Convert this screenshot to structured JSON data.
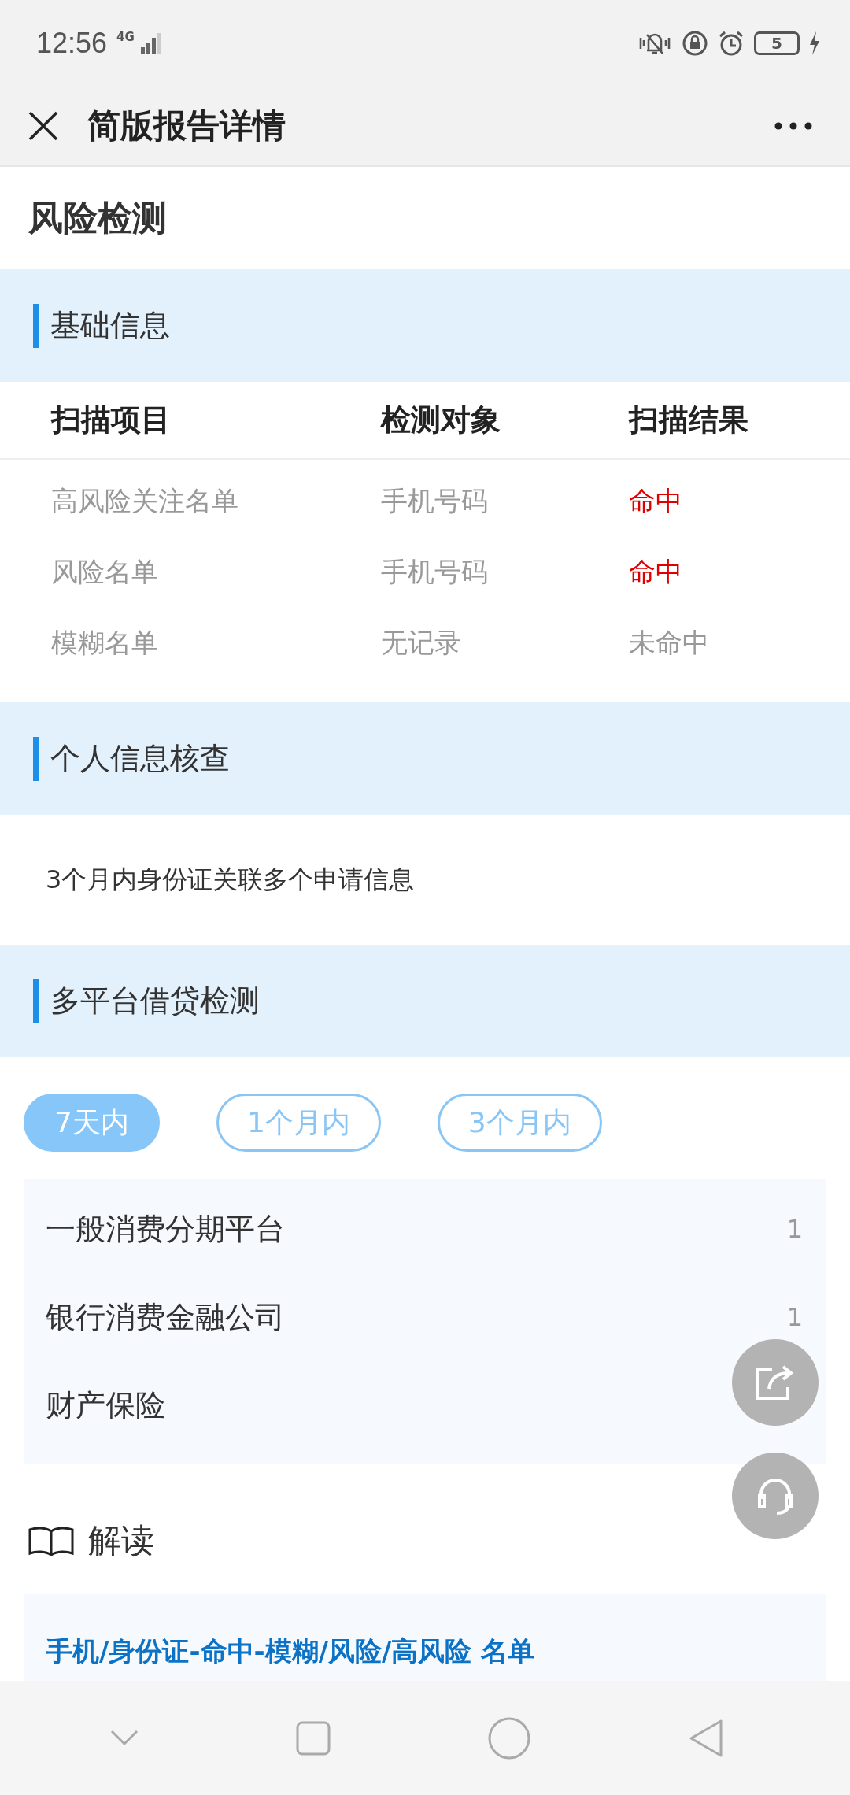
{
  "status_bar": {
    "time": "12:56",
    "network": "4G",
    "battery": "5"
  },
  "header": {
    "title": "简版报告详情"
  },
  "page_title": "风险检测",
  "basic_info": {
    "title": "基础信息",
    "columns": [
      "扫描项目",
      "检测对象",
      "扫描结果"
    ],
    "rows": [
      {
        "item": "高风险关注名单",
        "target": "手机号码",
        "result": "命中",
        "hit": true
      },
      {
        "item": "风险名单",
        "target": "手机号码",
        "result": "命中",
        "hit": true
      },
      {
        "item": "模糊名单",
        "target": "无记录",
        "result": "未命中",
        "hit": false
      }
    ]
  },
  "personal_check": {
    "title": "个人信息核查",
    "text": "3个月内身份证关联多个申请信息"
  },
  "multi_platform": {
    "title": "多平台借贷检测",
    "tabs": [
      {
        "label": "7天内",
        "selected": true
      },
      {
        "label": "1个月内",
        "selected": false
      },
      {
        "label": "3个月内",
        "selected": false
      }
    ],
    "rows": [
      {
        "name": "一般消费分期平台",
        "count": "1"
      },
      {
        "name": "银行消费金融公司",
        "count": "1"
      },
      {
        "name": "财产保险"
      }
    ]
  },
  "interpretation": {
    "title": "解读",
    "card_title": "手机/身份证-命中-模糊/风险/高风险 名单"
  }
}
